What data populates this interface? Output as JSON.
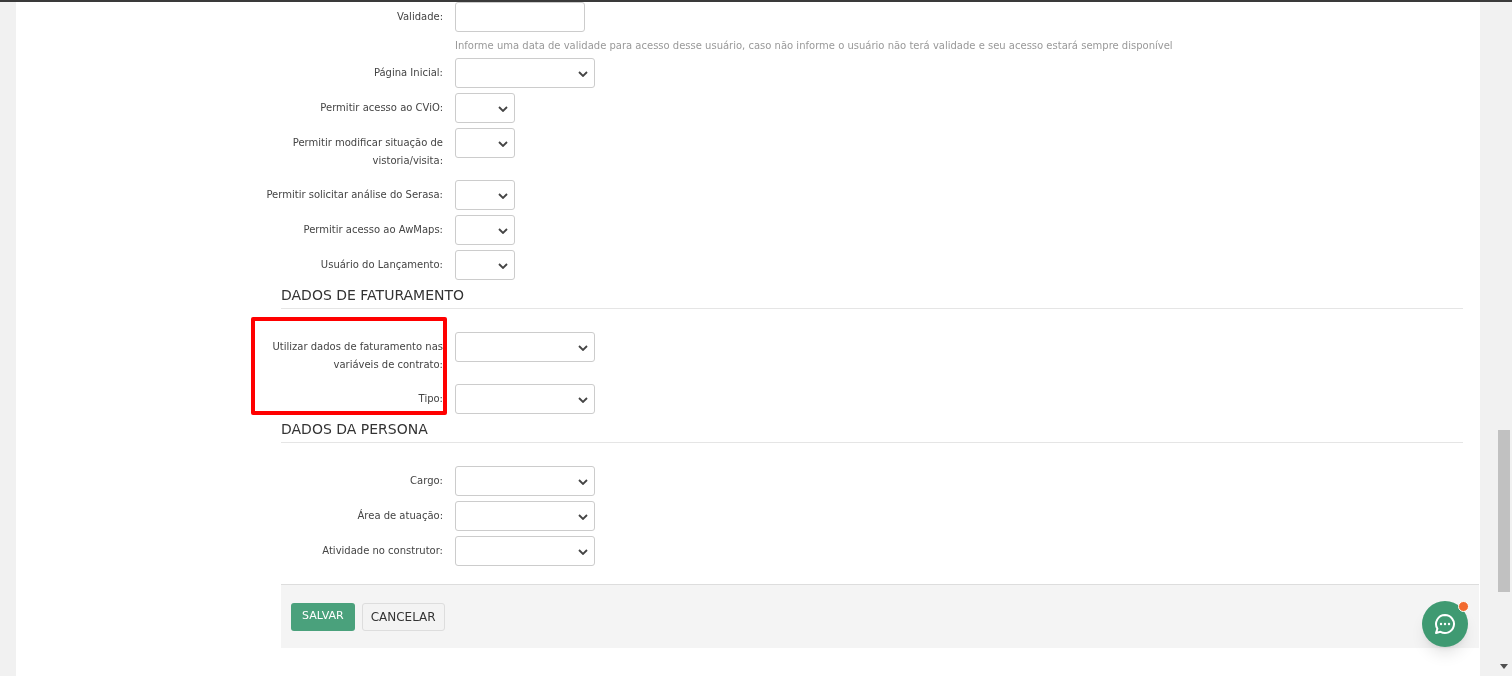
{
  "sections": [
    {
      "fields": [
        {
          "label": "Validade:",
          "kind": "text",
          "help": "Informe uma data de validade para acesso desse usuário, caso não informe o usuário não terá validade e seu acesso estará sempre disponível"
        },
        {
          "label": "Página Inicial:",
          "kind": "select"
        },
        {
          "label": "Permitir acesso ao CViO:",
          "kind": "yes-no"
        },
        {
          "label": "Permitir modificar situação de vistoria/visita:",
          "kind": "yes-no"
        },
        {
          "label": "Permitir solicitar análise do Serasa:",
          "kind": "yes-no"
        },
        {
          "label": "Permitir acesso ao AwMaps:",
          "kind": "yes-no"
        },
        {
          "label": "Usuário do Lançamento:",
          "kind": "yes-no"
        }
      ]
    },
    {
      "title": "DADOS DE FATURAMENTO",
      "highlighted": true,
      "fields": [
        {
          "label": "Utilizar dados de faturamento nas variáveis de contrato:",
          "kind": "select"
        },
        {
          "label": "Tipo:",
          "kind": "select"
        }
      ]
    },
    {
      "title": "DADOS DA PERSONA",
      "highlighted": false,
      "fields": [
        {
          "label": "Cargo:",
          "kind": "select"
        },
        {
          "label": "Área de atuação:",
          "kind": "select"
        },
        {
          "label": "Atividade no construtor:",
          "kind": "select"
        }
      ]
    }
  ],
  "buttons": [
    {
      "label": "SALVAR",
      "kind": "primary"
    },
    {
      "label": "CANCELAR",
      "kind": "secondary"
    }
  ]
}
